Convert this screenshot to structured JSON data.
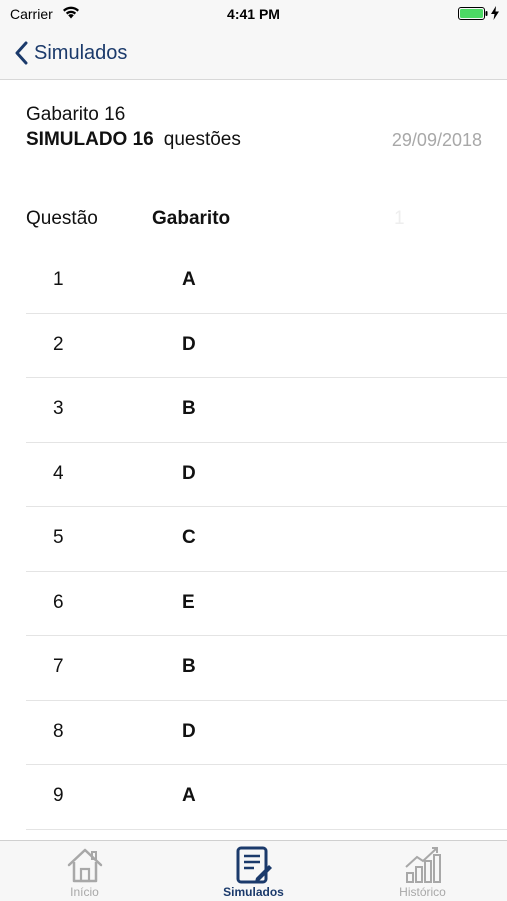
{
  "status_bar": {
    "carrier": "Carrier",
    "time": "4:41 PM"
  },
  "nav": {
    "back_label": "Simulados"
  },
  "header": {
    "title": "Gabarito 16",
    "sim_name": "SIMULADO 16",
    "questions_label": "questões",
    "date": "29/09/2018"
  },
  "columns": {
    "questao": "Questão",
    "gabarito": "Gabarito",
    "faint": "1"
  },
  "answers": [
    {
      "num": "1",
      "ans": "A"
    },
    {
      "num": "2",
      "ans": "D"
    },
    {
      "num": "3",
      "ans": "B"
    },
    {
      "num": "4",
      "ans": "D"
    },
    {
      "num": "5",
      "ans": "C"
    },
    {
      "num": "6",
      "ans": "E"
    },
    {
      "num": "7",
      "ans": "B"
    },
    {
      "num": "8",
      "ans": "D"
    },
    {
      "num": "9",
      "ans": "A"
    }
  ],
  "tabs": [
    {
      "label": "Início",
      "icon": "home-icon",
      "active": false
    },
    {
      "label": "Simulados",
      "icon": "document-edit-icon",
      "active": true
    },
    {
      "label": "Histórico",
      "icon": "bar-chart-icon",
      "active": false
    }
  ],
  "colors": {
    "accent": "#1b3a6b",
    "inactive": "#a8a8a8",
    "battery": "#4cd964"
  }
}
